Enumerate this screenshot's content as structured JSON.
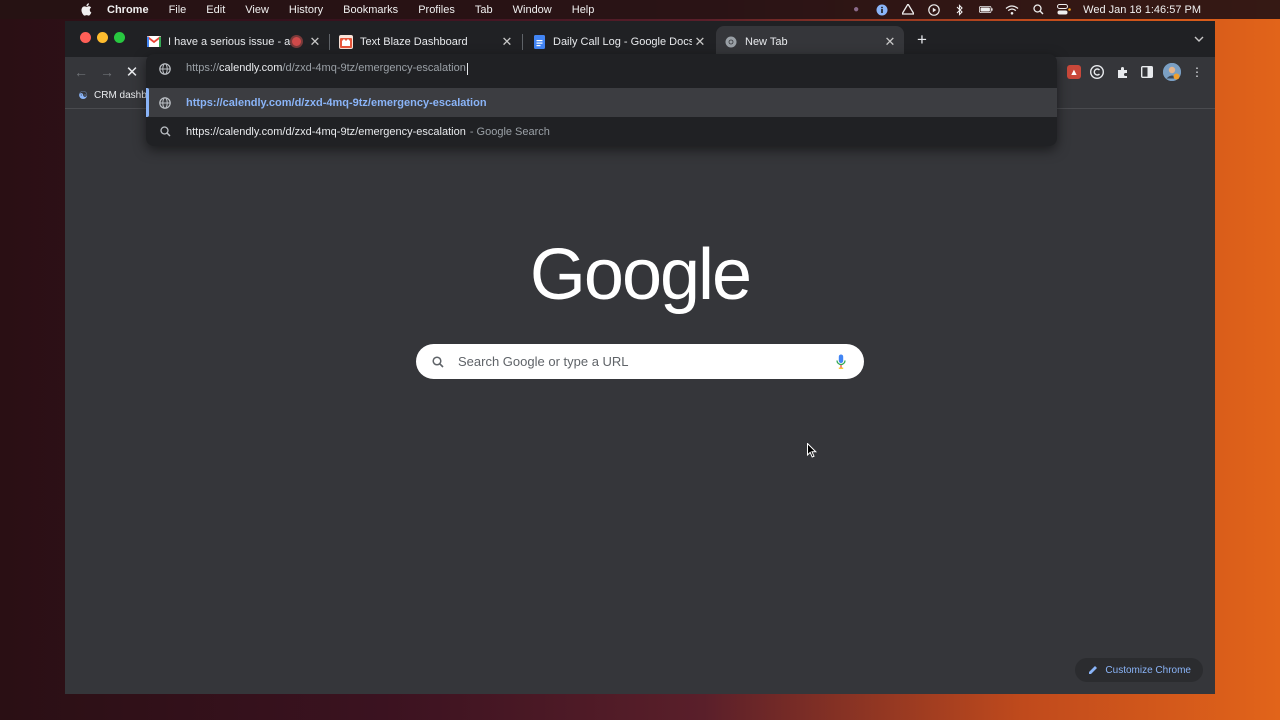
{
  "menubar": {
    "app_name": "Chrome",
    "menus": [
      "File",
      "Edit",
      "View",
      "History",
      "Bookmarks",
      "Profiles",
      "Tab",
      "Window",
      "Help"
    ],
    "clock": "Wed Jan 18  1:46:57 PM"
  },
  "tabs": [
    {
      "title": "I have a serious issue - and",
      "favicon": "gmail-icon"
    },
    {
      "title": "Text Blaze Dashboard",
      "favicon": "text-blaze-icon"
    },
    {
      "title": "Daily Call Log - Google Docs",
      "favicon": "google-docs-icon"
    },
    {
      "title": "New Tab",
      "favicon": "chrome-icon"
    }
  ],
  "bookmarks": [
    {
      "label": "CRM dashb"
    }
  ],
  "omnibox": {
    "scheme": "https://",
    "host": "calendly.com",
    "path": "/d/zxd-4mq-9tz/emergency-escalation",
    "suggestions": [
      {
        "text": "https://calendly.com/d/zxd-4mq-9tz/emergency-escalation",
        "suffix": ""
      },
      {
        "text": "https://calendly.com/d/zxd-4mq-9tz/emergency-escalation",
        "suffix": "- Google Search"
      }
    ]
  },
  "ntp": {
    "logo": "Google",
    "search_placeholder": "Search Google or type a URL",
    "customize_label": "Customize Chrome"
  },
  "colors": {
    "accent": "#8ab4f8",
    "tabstrip": "#202124",
    "toolbar": "#35363a"
  }
}
